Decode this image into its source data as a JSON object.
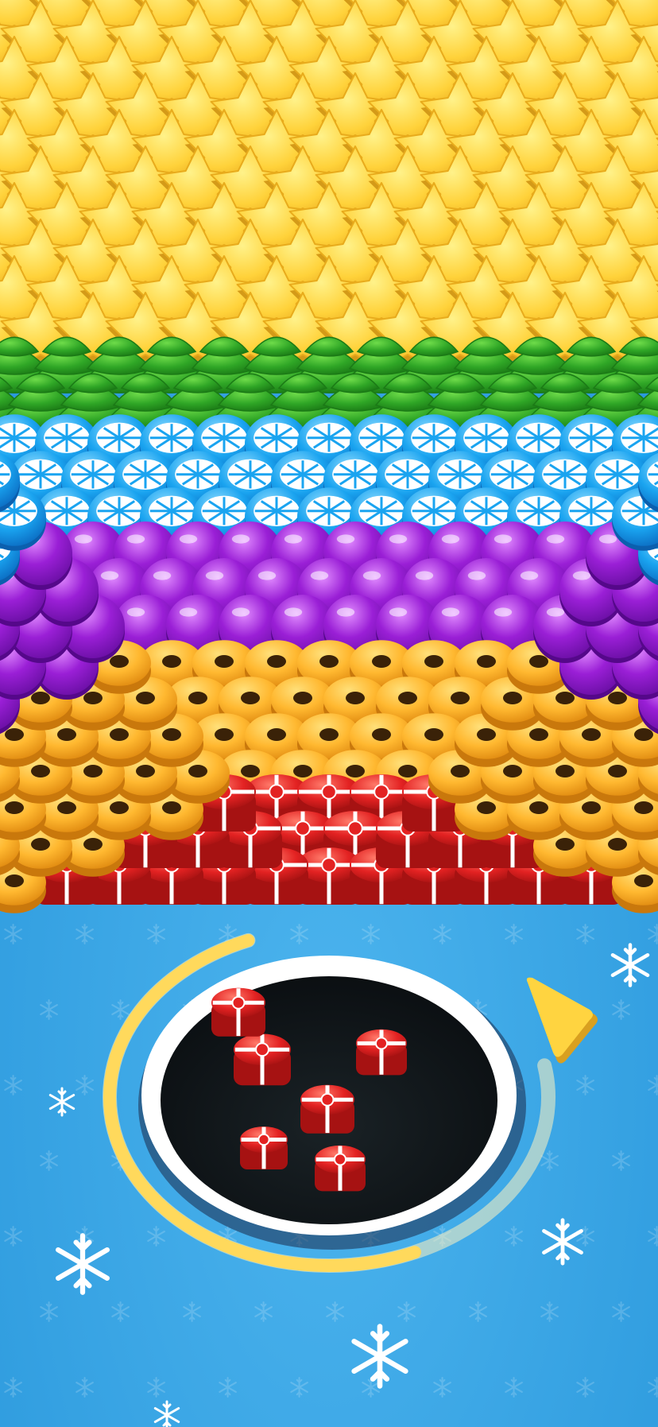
{
  "scene": {
    "description_free": true,
    "colors": {
      "floor": "#33a5e6",
      "floor_light": "#4cb4ee",
      "floor_pattern": "#2b96d6",
      "hole_rim": "#ffffff",
      "hole_rim_shadow": "#1b2a4a",
      "hole_inside": "#0f1418",
      "progress_ring": "#ffd95c",
      "progress_track": "#fff3c0",
      "pointer": "#ffd440",
      "star": "#ffd23a",
      "tree": "#2fa626",
      "orange_ball": "#1aa4f0",
      "purple_ball": "#9a1fd6",
      "donut": "#ffb830",
      "gift": "#e32222",
      "ribbon": "#ffffff"
    },
    "object_rows": [
      {
        "type": "star",
        "icon": "star-icon"
      },
      {
        "type": "christmas-tree",
        "icon": "tree-icon"
      },
      {
        "type": "orange-slice-ball",
        "icon": "orange-slice-icon"
      },
      {
        "type": "purple-ball",
        "icon": "ball-icon"
      },
      {
        "type": "donut",
        "icon": "donut-icon"
      },
      {
        "type": "gift-box",
        "icon": "gift-icon"
      }
    ],
    "hole": {
      "icon": "black-hole-icon"
    },
    "progress": {
      "fraction": 0.7,
      "icon": "progress-ring-icon"
    },
    "direction_pointer": {
      "icon": "triangle-pointer-icon"
    },
    "decorations": [
      {
        "icon": "snowflake-icon"
      },
      {
        "icon": "snowflake-icon"
      },
      {
        "icon": "snowflake-icon"
      },
      {
        "icon": "snowflake-icon"
      },
      {
        "icon": "snowflake-icon"
      },
      {
        "icon": "snowflake-icon"
      }
    ]
  }
}
